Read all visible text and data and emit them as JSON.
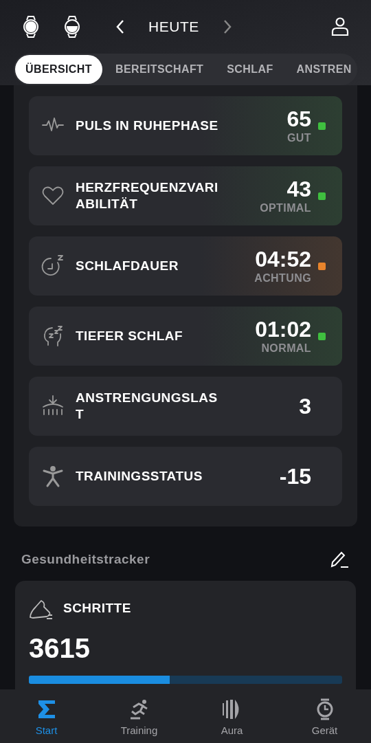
{
  "header": {
    "title": "HEUTE"
  },
  "tabs": [
    {
      "label": "ÜBERSICHT",
      "selected": true
    },
    {
      "label": "BEREITSCHAFT",
      "selected": false
    },
    {
      "label": "SCHLAF",
      "selected": false
    },
    {
      "label": "ANSTREN",
      "selected": false
    }
  ],
  "metrics": [
    {
      "kind": "pulse",
      "label": "PULS IN RUHEPHASE",
      "value": "65",
      "status": "GUT",
      "color": "#3fbf3f"
    },
    {
      "kind": "heart",
      "label": "HERZFREQUENZVARIABILITÄT",
      "value": "43",
      "status": "OPTIMAL",
      "color": "#3fbf3f"
    },
    {
      "kind": "sleep",
      "label": "SCHLAFDAUER",
      "value": "04:52",
      "status": "ACHTUNG",
      "color": "#e8842c"
    },
    {
      "kind": "deep",
      "label": "TIEFER SCHLAF",
      "value": "01:02",
      "status": "NORMAL",
      "color": "#3fbf3f"
    },
    {
      "kind": "load",
      "label": "ANSTRENGUNGSLAST",
      "value": "3"
    },
    {
      "kind": "person",
      "label": "TRAININGSSTATUS",
      "value": "-15"
    }
  ],
  "tracker": {
    "title": "Gesundheitstracker",
    "card": {
      "label": "SCHRITTE",
      "value": "3615",
      "level": 0.45
    }
  },
  "nav": [
    {
      "kind": "sigma",
      "label": "Start",
      "selected": true
    },
    {
      "kind": "run",
      "label": "Training",
      "selected": false
    },
    {
      "kind": "aura",
      "label": "Aura",
      "selected": false
    },
    {
      "kind": "watch",
      "label": "Gerät",
      "selected": false
    }
  ]
}
